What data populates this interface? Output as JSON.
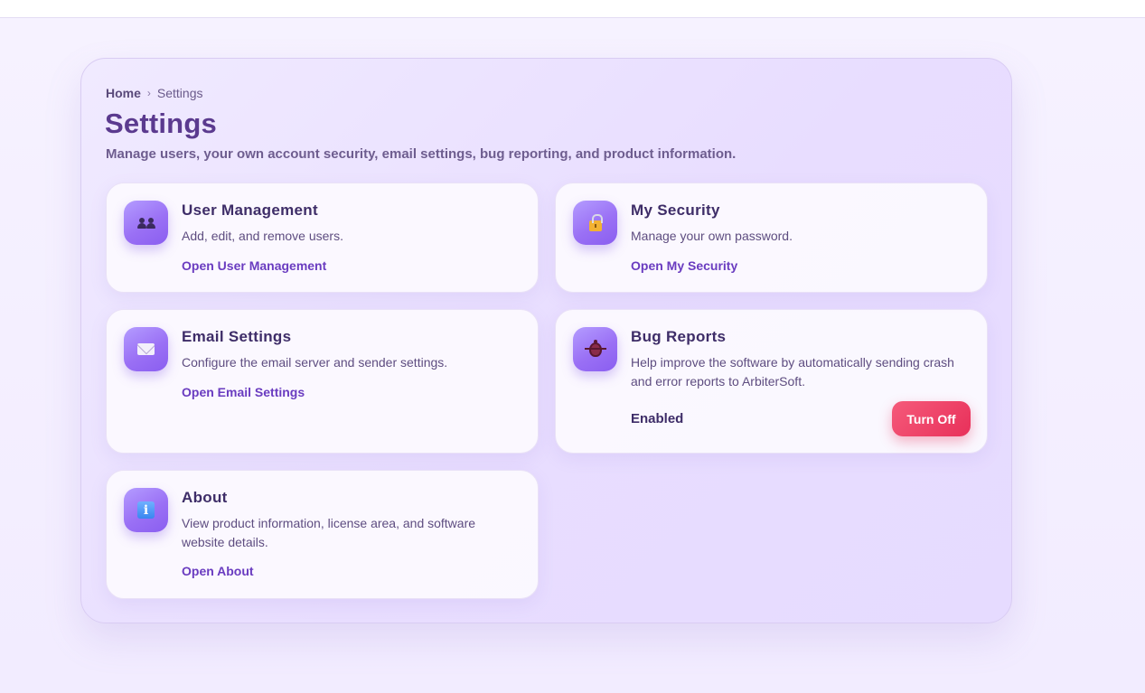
{
  "breadcrumb": {
    "home": "Home",
    "separator": "›",
    "current": "Settings"
  },
  "page": {
    "title": "Settings",
    "subtitle": "Manage users, your own account security, email settings, bug reporting, and product information."
  },
  "cards": {
    "user_management": {
      "title": "User Management",
      "description": "Add, edit, and remove users.",
      "link": "Open User Management",
      "icon": "users-icon"
    },
    "my_security": {
      "title": "My Security",
      "description": "Manage your own password.",
      "link": "Open My Security",
      "icon": "lock-icon"
    },
    "email_settings": {
      "title": "Email Settings",
      "description": "Configure the email server and sender settings.",
      "link": "Open Email Settings",
      "icon": "envelope-icon"
    },
    "bug_reports": {
      "title": "Bug Reports",
      "description": "Help improve the software by automatically sending crash and error reports to ArbiterSoft.",
      "status": "Enabled",
      "button": "Turn Off",
      "icon": "bug-icon"
    },
    "about": {
      "title": "About",
      "description": "View product information, license area, and software website details.",
      "link": "Open About",
      "icon": "info-icon",
      "icon_glyph": "i"
    }
  },
  "colors": {
    "accent": "#6a3cc0",
    "title": "#5b3a8f",
    "danger": "#e8305a",
    "icon_gradient_start": "#b49cff",
    "icon_gradient_end": "#8a5ef0"
  }
}
